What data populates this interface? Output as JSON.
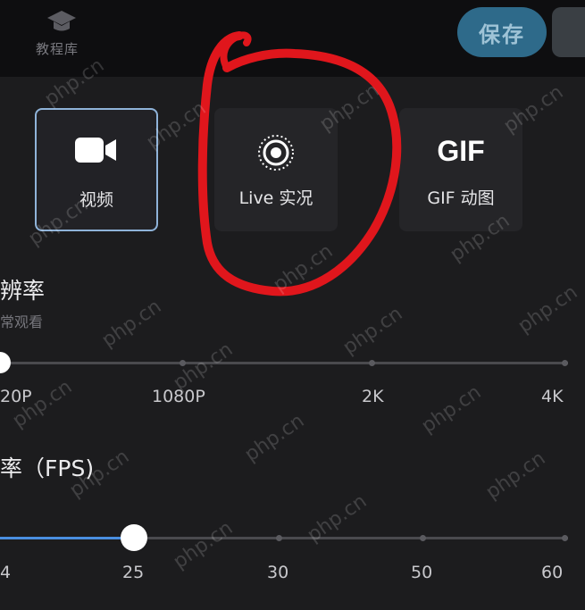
{
  "header": {
    "logo_text": "教程库",
    "save_label": "保存"
  },
  "modes": [
    {
      "label": "视频",
      "icon": "video-camera-icon",
      "selected": true
    },
    {
      "label": "Live 实况",
      "icon": "live-photo-icon",
      "selected": false
    },
    {
      "label": "GIF 动图",
      "icon_text": "GIF",
      "selected": false
    }
  ],
  "resolution": {
    "title": "辨率",
    "subtitle": "常观看",
    "ticks": [
      "20P",
      "1080P",
      "2K",
      "4K"
    ],
    "selected": "20P"
  },
  "frame_rate": {
    "title": "率（FPS)",
    "ticks": [
      "4",
      "25",
      "30",
      "50",
      "60"
    ],
    "selected": "25"
  },
  "watermark": "php.cn",
  "colors": {
    "accent": "#4a8fe0",
    "annotation": "#e0161c",
    "save_button": "#2e6a8a"
  }
}
